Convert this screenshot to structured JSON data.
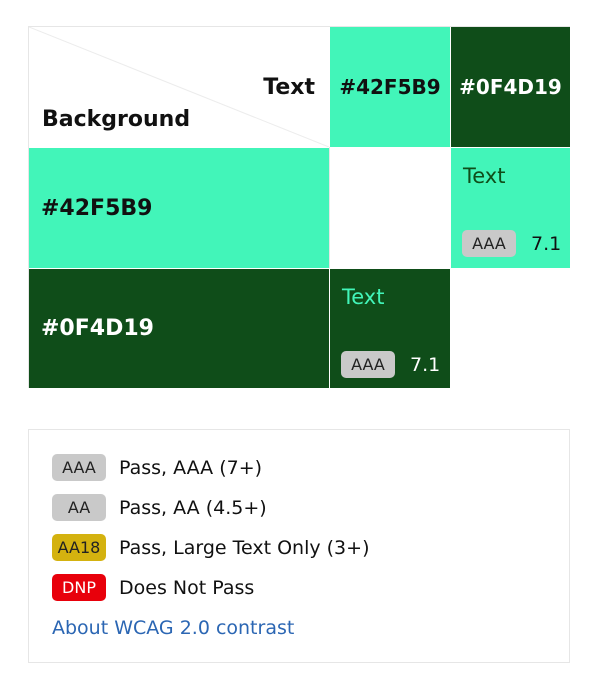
{
  "matrix": {
    "corner": {
      "text_label": "Text",
      "background_label": "Background"
    },
    "columns": [
      {
        "label": "#42F5B9",
        "color": "#42F5B9"
      },
      {
        "label": "#0F4D19",
        "color": "#0F4D19"
      }
    ],
    "rows": [
      {
        "label": "#42F5B9",
        "color": "#42F5B9"
      },
      {
        "label": "#0F4D19",
        "color": "#0F4D19"
      }
    ],
    "samples": [
      {
        "background": "#42F5B9",
        "text_color": "#0F4D19",
        "sample_text": "Text",
        "badge": "AAA",
        "ratio": "7.1"
      },
      {
        "background": "#0F4D19",
        "text_color": "#42F5B9",
        "sample_text": "Text",
        "badge": "AAA",
        "ratio": "7.1"
      }
    ]
  },
  "legend": {
    "items": [
      {
        "badge": "AAA",
        "description": "Pass, AAA (7+)",
        "badge_color": "#c9c9c9"
      },
      {
        "badge": "AA",
        "description": "Pass, AA (4.5+)",
        "badge_color": "#c9c9c9"
      },
      {
        "badge": "AA18",
        "description": "Pass, Large Text Only (3+)",
        "badge_color": "#d4b20f"
      },
      {
        "badge": "DNP",
        "description": "Does Not Pass",
        "badge_color": "#e8000b"
      }
    ],
    "link_text": "About WCAG 2.0 contrast"
  }
}
